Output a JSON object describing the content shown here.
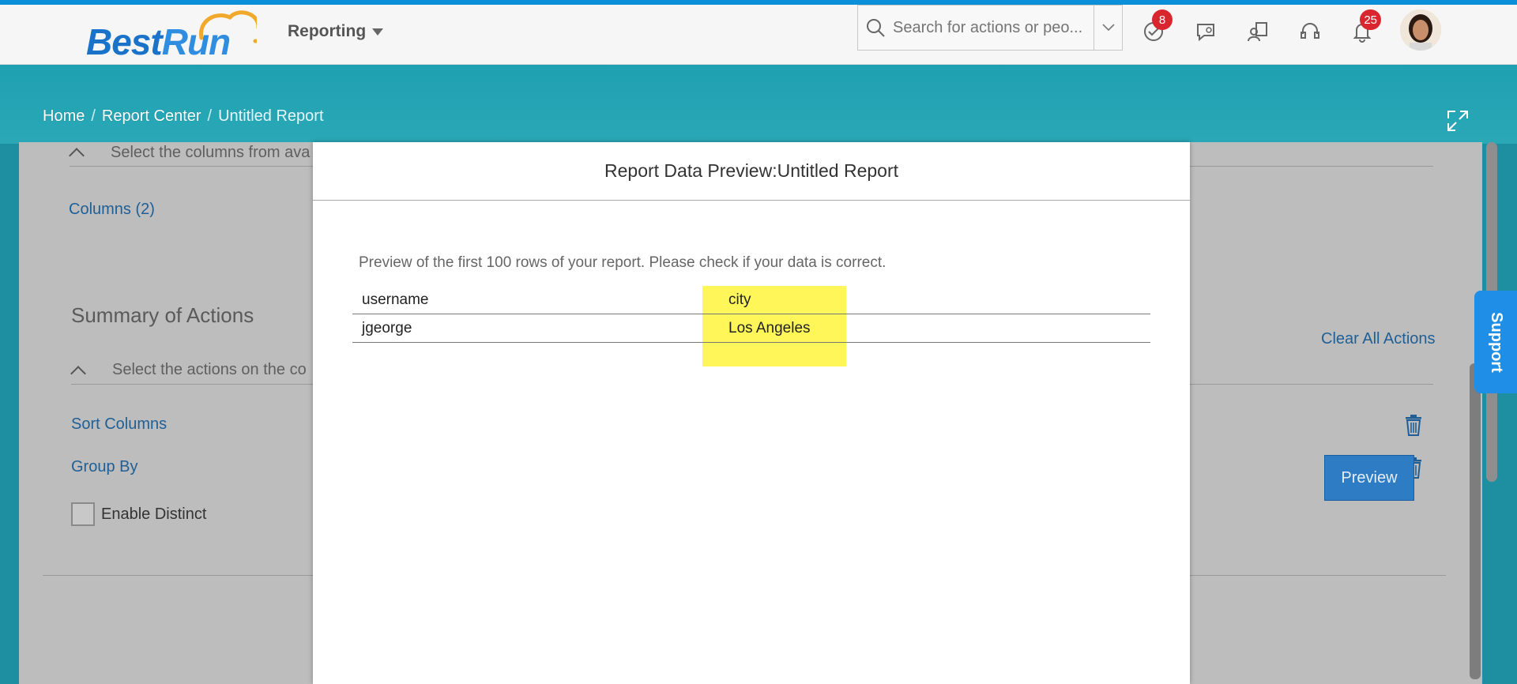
{
  "shell": {
    "logo_best": "Best",
    "logo_run": "Run",
    "product_menu": "Reporting",
    "search_placeholder": "Search for actions or peo...",
    "notifications_todo_count": "8",
    "notifications_bell_count": "25"
  },
  "breadcrumb": {
    "home": "Home",
    "report_center": "Report Center",
    "current": "Untitled Report"
  },
  "page": {
    "columns_hint": "Select the columns from ava",
    "columns_link": "Columns (2)",
    "summary_title": "Summary of Actions",
    "actions_hint": "Select the actions on the co",
    "clear_all": "Clear All Actions",
    "sort_columns": "Sort Columns",
    "group_by": "Group By",
    "enable_distinct": "Enable Distinct",
    "preview_button": "Preview"
  },
  "support_label": "Support",
  "dialog": {
    "title": "Report Data Preview:Untitled Report",
    "description": "Preview of the first 100 rows of your report. Please check if your data is correct.",
    "columns": [
      "username",
      "city"
    ],
    "rows": [
      [
        "jgeorge",
        "Los Angeles"
      ]
    ]
  },
  "colors": {
    "brand_blue": "#1a73c9",
    "shell_accent": "#0a8fd8",
    "highlight": "#fff75a",
    "badge_red": "#d9262e",
    "support_blue": "#1e8ee6"
  }
}
